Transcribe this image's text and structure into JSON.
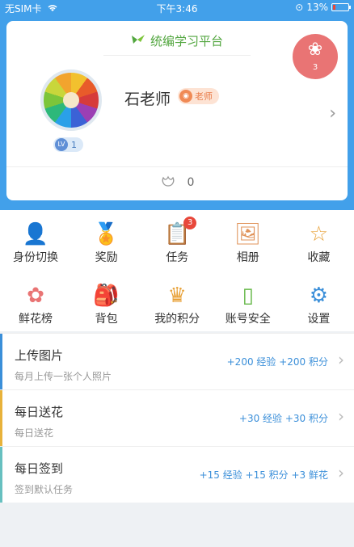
{
  "status_bar": {
    "carrier": "无SIM卡",
    "time": "下午3:46",
    "battery": "13%"
  },
  "profile": {
    "platform_name": "统编学习平台",
    "name": "石老师",
    "role": "老师",
    "level_label": "LV",
    "level_value": "1",
    "flower_count": "0",
    "fab_count": "3"
  },
  "grid": [
    {
      "label": "身份切换",
      "icon": "switch-identity-icon",
      "color": "#e8b23a"
    },
    {
      "label": "奖励",
      "icon": "medal-icon",
      "color": "#e8a23a"
    },
    {
      "label": "任务",
      "icon": "task-icon",
      "color": "#67b84a",
      "badge": "3"
    },
    {
      "label": "相册",
      "icon": "album-icon",
      "color": "#e0935a"
    },
    {
      "label": "收藏",
      "icon": "star-icon",
      "color": "#e8a23a"
    },
    {
      "label": "鲜花榜",
      "icon": "flower-rank-icon",
      "color": "#e97474"
    },
    {
      "label": "背包",
      "icon": "backpack-icon",
      "color": "#67b84a"
    },
    {
      "label": "我的积分",
      "icon": "crown-icon",
      "color": "#e8a23a"
    },
    {
      "label": "账号安全",
      "icon": "phone-icon",
      "color": "#67b84a"
    },
    {
      "label": "设置",
      "icon": "gear-icon",
      "color": "#3b8fd9"
    }
  ],
  "tasks": [
    {
      "title": "上传图片",
      "subtitle": "每月上传一张个人照片",
      "reward": "+200 经验 +200 积分",
      "accent": "#3b8fd9"
    },
    {
      "title": "每日送花",
      "subtitle": "每日送花",
      "reward": "+30 经验 +30 积分",
      "accent": "#e8b23a"
    },
    {
      "title": "每日签到",
      "subtitle": "签到默认任务",
      "reward": "+15 经验 +15 积分 +3 鲜花",
      "accent": "#67c0c0"
    }
  ]
}
